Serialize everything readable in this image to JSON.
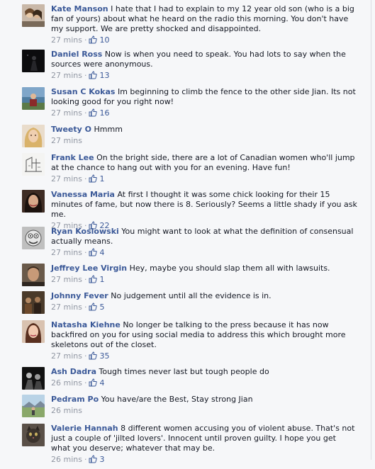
{
  "comments": [
    {
      "name": "Kate Manson",
      "text": "I hate that I had to explain to my 12 year old son (who is a big fan of yours) about what he heard on the radio this morning. You don't have my support. We are pretty shocked and disappointed.",
      "time": "27 mins",
      "likes": "10",
      "avatar_icon": "couple-photo-icon"
    },
    {
      "name": "Daniel Ross",
      "text": "Now is when you need to speak. You had lots to say when the sources were anonymous.",
      "time": "27 mins",
      "likes": "13",
      "avatar_icon": "dark-figure-photo-icon"
    },
    {
      "name": "Susan C Kokas",
      "text": "Im beginning to climb the fence to the other side Jian. Its not looking good for you right now!",
      "time": "27 mins",
      "likes": "16",
      "avatar_icon": "lake-portrait-photo-icon"
    },
    {
      "name": "Tweety O",
      "text": "Hmmm",
      "time": "27 mins",
      "likes": "",
      "avatar_icon": "blonde-portrait-photo-icon"
    },
    {
      "name": "Frank Lee",
      "text": "On the bright side, there are a lot of Canadian women who'll jump at the chance to hang out with you for an evening. Have fun!",
      "time": "27 mins",
      "likes": "1",
      "avatar_icon": "sketch-drawing-photo-icon"
    },
    {
      "name": "Vanessa Maria",
      "text": "At first I thought it was some chick looking for their 15 minutes of fame, but now there is 8. Seriously? Seems a little shady if you ask me.",
      "time": "27 mins",
      "likes": "22",
      "avatar_icon": "dark-hair-portrait-photo-icon"
    },
    {
      "name": "Ryan Koslowski",
      "text": "You might want to look at what the definition of consensual actually means.",
      "time": "27 mins",
      "likes": "4",
      "avatar_icon": "cartoon-face-icon"
    },
    {
      "name": "Jeffrey Lee Virgin",
      "text": "Hey, maybe you should slap them all with lawsuits.",
      "time": "27 mins",
      "likes": "1",
      "avatar_icon": "man-portrait-photo-icon"
    },
    {
      "name": "Johnny Fever",
      "text": "No judgement until all the evidence is in.",
      "time": "27 mins",
      "likes": "5",
      "avatar_icon": "group-photo-icon"
    },
    {
      "name": "Natasha Kiehne",
      "text": "No longer be talking to the press because it has now backfired on you for using social media to address this which brought more skeletons out of the closet.",
      "time": "27 mins",
      "likes": "35",
      "avatar_icon": "woman-portrait-photo-icon"
    },
    {
      "name": "Ash Dadra",
      "text": "Tough times never last but tough people do",
      "time": "26 mins",
      "likes": "4",
      "avatar_icon": "bw-photo-icon"
    },
    {
      "name": "Pedram Po",
      "text": "You have/are the Best, Stay strong Jian",
      "time": "26 mins",
      "likes": "",
      "avatar_icon": "landscape-photo-icon"
    },
    {
      "name": "Valerie Hannah",
      "text": "8 different women accusing you of violent abuse. That's not just a couple of 'jilted lovers'. Innocent until proven guilty. I hope you get what you deserve; whatever that may be.",
      "time": "26 mins",
      "likes": "3",
      "avatar_icon": "cat-photo-icon"
    }
  ],
  "colors": {
    "name": "#3b5998",
    "meta": "#9197a3",
    "background": "#f6f7f9"
  }
}
